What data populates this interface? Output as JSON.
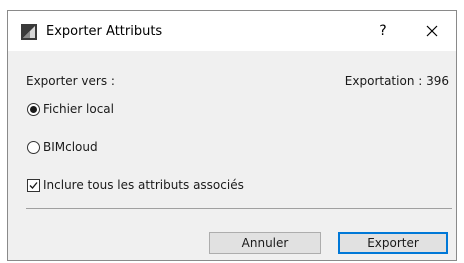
{
  "window": {
    "title": "Exporter Attributs",
    "help_label": "?"
  },
  "content": {
    "export_to_label": "Exporter vers :",
    "export_count_label": "Exportation : 396",
    "options": [
      {
        "label": "Fichier local",
        "selected": true
      },
      {
        "label": "BIMcloud",
        "selected": false
      }
    ],
    "include_checkbox": {
      "label": "Inclure tous les attributs associés",
      "checked": true
    }
  },
  "buttons": {
    "cancel_label": "Annuler",
    "export_label": "Exporter"
  },
  "colors": {
    "accent": "#0078d7",
    "dialog_bg": "#f0f0f0",
    "button_bg": "#e1e1e1"
  },
  "icons": {
    "app": "archicad-icon",
    "close": "close-icon"
  }
}
